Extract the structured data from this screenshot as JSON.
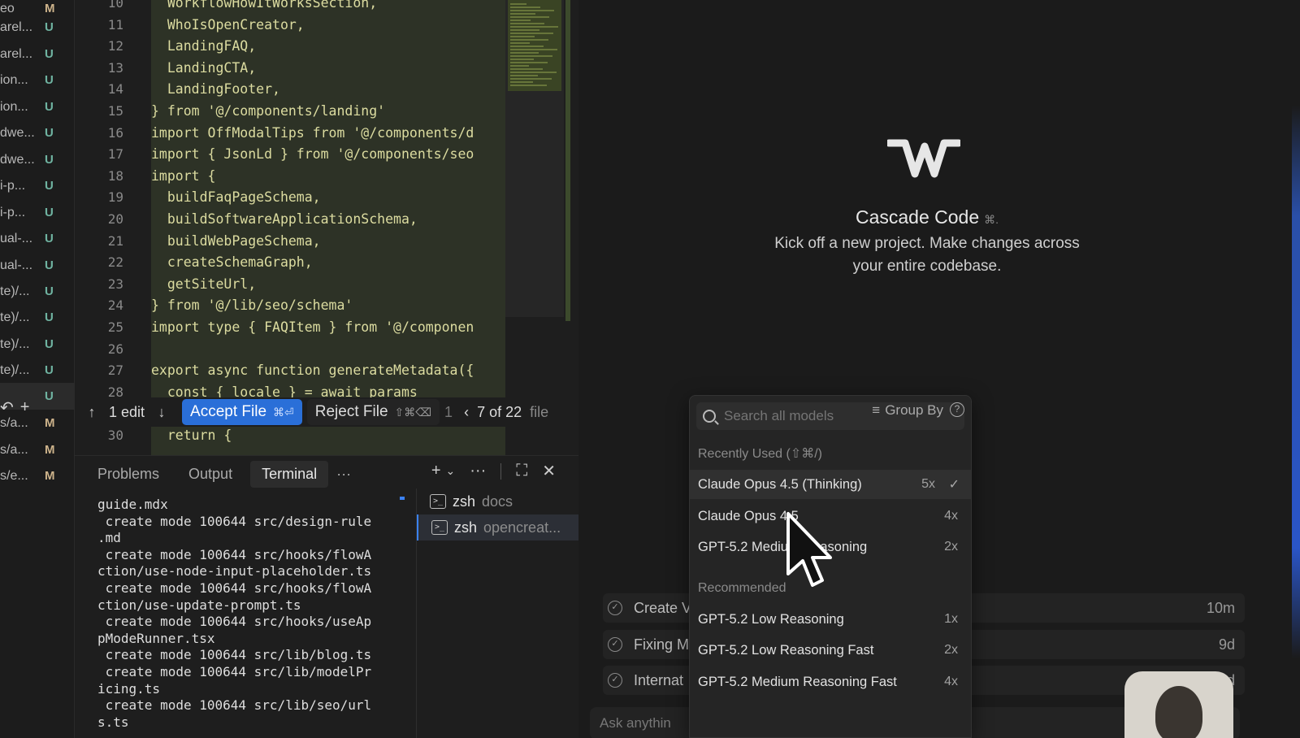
{
  "explorer": {
    "files": [
      {
        "name": "eo",
        "status": "M"
      },
      {
        "name": "arel...",
        "status": "U"
      },
      {
        "name": "arel...",
        "status": "U"
      },
      {
        "name": "ion...",
        "status": "U"
      },
      {
        "name": "ion...",
        "status": "U"
      },
      {
        "name": "dwe...",
        "status": "U"
      },
      {
        "name": "dwe...",
        "status": "U"
      },
      {
        "name": "i-p...",
        "status": "U"
      },
      {
        "name": "i-p...",
        "status": "U"
      },
      {
        "name": "ual-...",
        "status": "U"
      },
      {
        "name": "ual-...",
        "status": "U"
      },
      {
        "name": "te)/...",
        "status": "U"
      },
      {
        "name": "te)/...",
        "status": "U"
      },
      {
        "name": "te)/...",
        "status": "U"
      },
      {
        "name": "te)/...",
        "status": "U"
      },
      {
        "name": "",
        "status": "U"
      },
      {
        "name": "s/a...",
        "status": "M"
      },
      {
        "name": "s/a...",
        "status": "M"
      },
      {
        "name": "s/e...",
        "status": "M"
      }
    ]
  },
  "editor": {
    "line_numbers": [
      "10",
      "11",
      "12",
      "13",
      "14",
      "15",
      "16",
      "17",
      "18",
      "19",
      "20",
      "21",
      "22",
      "23",
      "24",
      "25",
      "26",
      "27",
      "28",
      "",
      "30"
    ],
    "lines": [
      "  WorkflowHowItWorksSection,",
      "  WhoIsOpenCreator,",
      "  LandingFAQ,",
      "  LandingCTA,",
      "  LandingFooter,",
      "} from '@/components/landing'",
      "import OffModalTips from '@/components/d",
      "import { JsonLd } from '@/components/seo",
      "import {",
      "  buildFaqPageSchema,",
      "  buildSoftwareApplicationSchema,",
      "  buildWebPageSchema,",
      "  createSchemaGraph,",
      "  getSiteUrl,",
      "} from '@/lib/seo/schema'",
      "import type { FAQItem } from '@/componen",
      "",
      "export async function generateMetadata({",
      "  const { locale } = await params",
      "",
      "  return {"
    ]
  },
  "diff_bar": {
    "edit_count": "1 edit",
    "accept_label": "Accept File",
    "accept_kbd": "⌘⏎",
    "reject_label": "Reject File",
    "reject_kbd": "⇧⌘⌫",
    "pager": "7 of 22",
    "pager_suffix": "file",
    "extra": "1"
  },
  "panel": {
    "tabs": [
      "Problems",
      "Output",
      "Terminal"
    ],
    "active_tab": "Terminal",
    "more": "···",
    "terminal_output": "guide.mdx\n create mode 100644 src/design-rule\n.md\n create mode 100644 src/hooks/flowA\nction/use-node-input-placeholder.ts\n create mode 100644 src/hooks/flowA\nction/use-update-prompt.ts\n create mode 100644 src/hooks/useAp\npModeRunner.tsx\n create mode 100644 src/lib/blog.ts\n create mode 100644 src/lib/modelPr\nicing.ts\n create mode 100644 src/lib/seo/url\ns.ts",
    "sessions": [
      {
        "name": "zsh",
        "sub": "docs"
      },
      {
        "name": "zsh",
        "sub": "opencreat..."
      }
    ]
  },
  "cascade": {
    "title": "Cascade Code",
    "title_kbd": "⌘.",
    "description": "Kick off a new project. Make changes across your entire codebase.",
    "history": [
      {
        "label": "Create V",
        "time": "10m"
      },
      {
        "label": "Fixing M",
        "time": "9d"
      },
      {
        "label": "Internat",
        "time": "9d"
      }
    ],
    "input_placeholder": "Ask anythin"
  },
  "model_menu": {
    "search_placeholder": "Search all models",
    "group_by": "Group By",
    "recent_label": "Recently Used (⇧⌘/)",
    "recent": [
      {
        "name": "Claude Opus 4.5 (Thinking)",
        "mult": "5x",
        "selected": true
      },
      {
        "name": "Claude Opus 4.5",
        "mult": "4x"
      },
      {
        "name": "GPT-5.2 Medium Reasoning",
        "mult": "2x"
      }
    ],
    "recommended_label": "Recommended",
    "recommended": [
      {
        "name": "GPT-5.2 Low Reasoning",
        "mult": "1x"
      },
      {
        "name": "GPT-5.2 Low Reasoning Fast",
        "mult": "2x"
      },
      {
        "name": "GPT-5.2 Medium Reasoning Fast",
        "mult": "4x"
      }
    ]
  },
  "colors": {
    "accent": "#2a6fd8",
    "status_untracked": "#6fb3a1",
    "status_modified": "#cdb38b",
    "diff_added_bg": "#2d3226"
  }
}
